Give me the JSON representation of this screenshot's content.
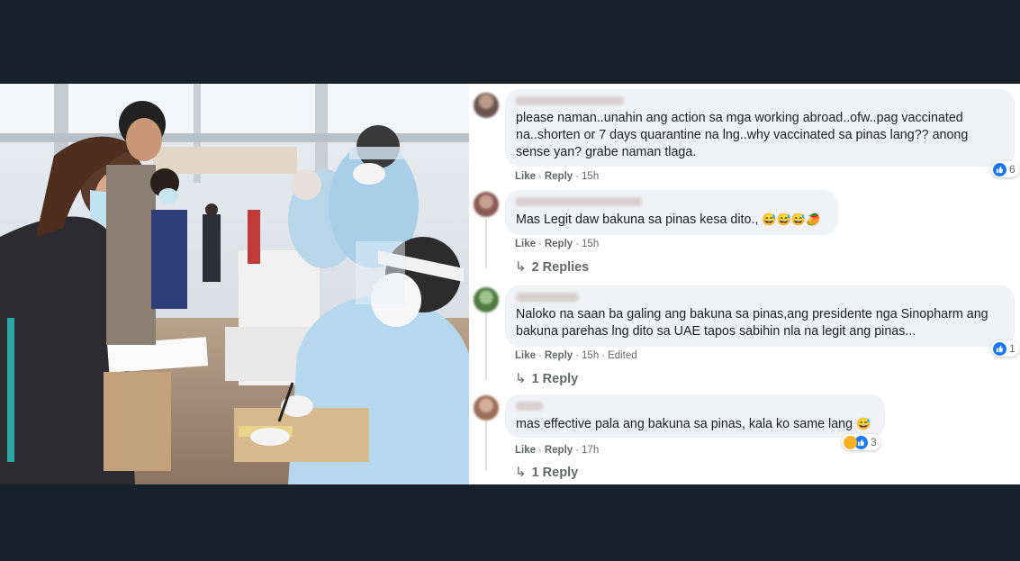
{
  "comments": [
    {
      "text": "please naman..unahin ang action sa mga working abroad..ofw..pag vaccinated na..shorten or 7 days quarantine na lng..why vaccinated sa pinas lang?? anong sense yan? grabe naman tlaga.",
      "like": "Like",
      "reply": "Reply",
      "time": "15h",
      "reaction_count": "6"
    },
    {
      "text": "Mas Legit daw bakuna sa pinas kesa dito.,",
      "emojis": "😅😅😅🥭",
      "like": "Like",
      "reply": "Reply",
      "time": "15h",
      "replies": "2 Replies"
    },
    {
      "text": "Naloko na saan ba galing ang bakuna sa pinas,ang presidente nga Sinopharm ang bakuna parehas lng dito sa UAE tapos sabihin nla na legit ang pinas...",
      "like": "Like",
      "reply": "Reply",
      "time": "15h",
      "edited": "Edited",
      "reaction_count": "1",
      "replies": "1 Reply"
    },
    {
      "text": "mas effective pala ang bakuna sa pinas, kala ko same lang",
      "emojis": "😅",
      "like": "Like",
      "reply": "Reply",
      "time": "17h",
      "reaction_count": "3",
      "replies": "1 Reply"
    }
  ],
  "colors": {
    "link_blue": "#1877f2",
    "bubble": "#f0f2f5",
    "page_bg": "#17212b"
  },
  "icons": [
    "reply-arrow-icon",
    "like-reaction-icon",
    "haha-reaction-icon"
  ]
}
